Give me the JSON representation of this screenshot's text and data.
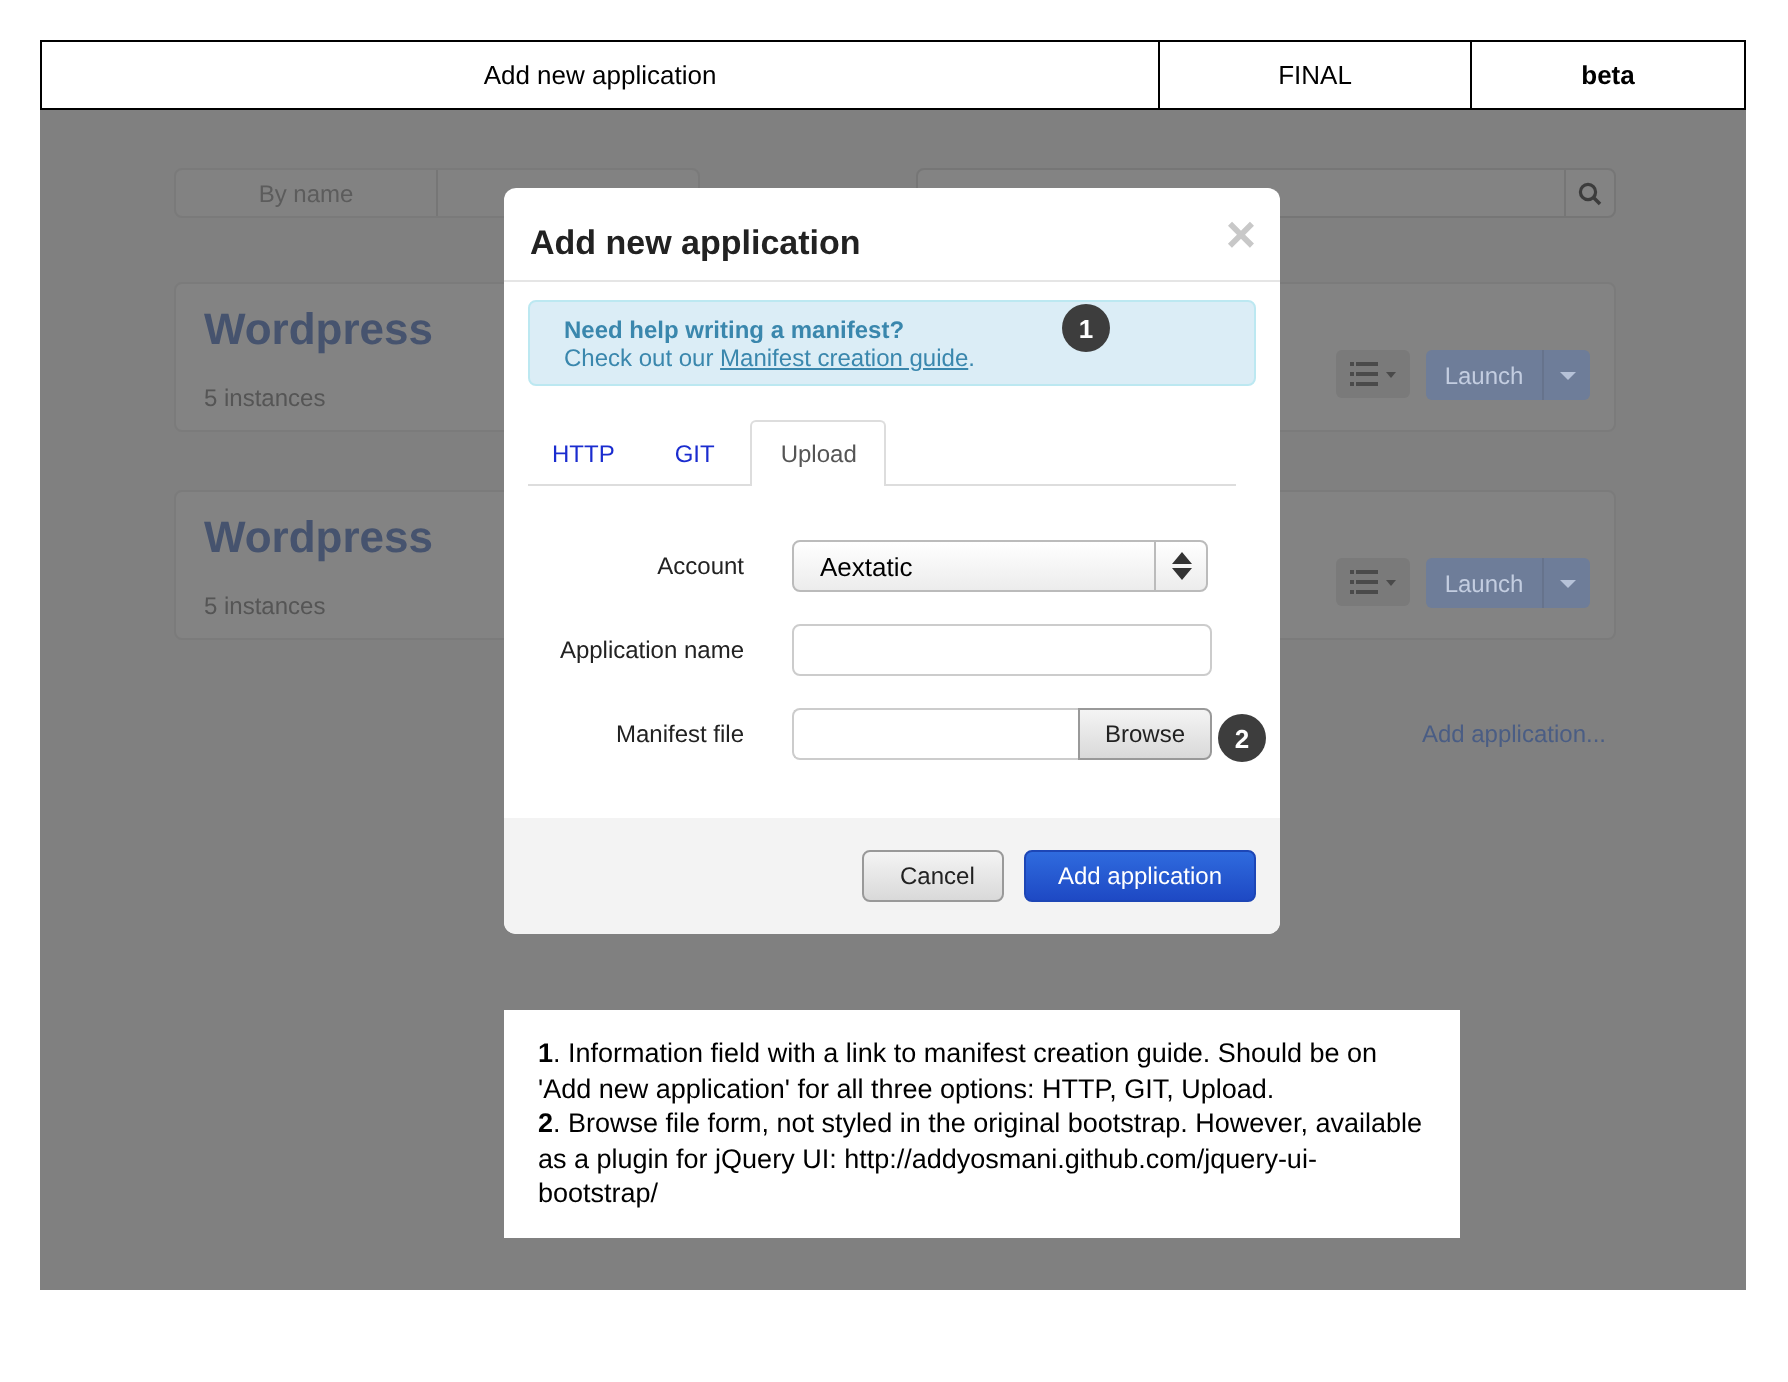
{
  "header": {
    "title": "Add new application",
    "status": "FINAL",
    "version": "beta"
  },
  "background": {
    "sort_tabs": [
      "By name"
    ],
    "apps": [
      {
        "name": "Wordpress",
        "instances": "5 instances",
        "launch": "Launch"
      },
      {
        "name": "Wordpress",
        "instances": "5 instances",
        "launch": "Launch"
      }
    ],
    "add_link": "Add application..."
  },
  "dialog": {
    "title": "Add new application",
    "close": "×",
    "alert": {
      "heading": "Need help writing a manifest?",
      "text_before": "Check out our ",
      "link": "Manifest creation guide",
      "text_after": "."
    },
    "tabs": [
      {
        "label": "HTTP",
        "selected": false
      },
      {
        "label": "GIT",
        "selected": false
      },
      {
        "label": "Upload",
        "selected": true
      }
    ],
    "fields": [
      {
        "kind": "select",
        "label": "Account",
        "value": "Aextatic"
      },
      {
        "kind": "text",
        "label": "Application name"
      },
      {
        "kind": "file",
        "label": "Manifest file",
        "button": "Browse"
      }
    ],
    "buttons": [
      {
        "kind": "default",
        "label": "Cancel"
      },
      {
        "kind": "primary",
        "label": "Add application"
      }
    ]
  },
  "markers": [
    "1",
    "2"
  ],
  "note": [
    "**1**. Information field with a link to manifest creation guide. Should be on 'Add new application' for all three options: HTTP, GIT, Upload.",
    "**2**. Browse file form, not styled in the original bootstrap. However, available as a plugin for jQuery UI: http://addyosmani.github.com/jquery-ui-bootstrap/"
  ]
}
